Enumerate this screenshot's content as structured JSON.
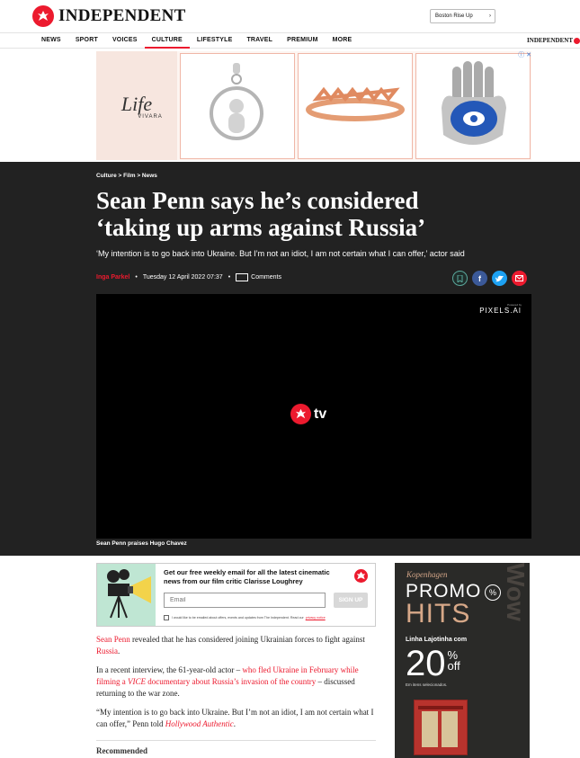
{
  "header": {
    "logo_text": "INDEPENDENT",
    "edition_label": "Boston Rise Up",
    "brand_color": "#ec1a2e"
  },
  "nav": {
    "items": [
      "NEWS",
      "SPORT",
      "VOICES",
      "CULTURE",
      "LIFESTYLE",
      "TRAVEL",
      "PREMIUM",
      "MORE"
    ],
    "active": "CULTURE",
    "right_logo_text": "INDEPENDENT"
  },
  "ad": {
    "brand": "Life",
    "sub_brand": "VIVARA"
  },
  "article": {
    "breadcrumb": "Culture > Film > News",
    "headline_line1": "Sean Penn says he’s considered",
    "headline_line2": "‘taking up arms against Russia’",
    "standfirst": "‘My intention is to go back into Ukraine. But I’m not an idiot, I am not certain what I can offer,’ actor said",
    "author": "Inga Parkel",
    "date": "Tuesday 12 April 2022 07:37",
    "comments_label": "Comments",
    "video": {
      "sponsor_small": "Powered by",
      "sponsor": "PIXELS.AI",
      "tv_label": "tv",
      "caption": "Sean Penn praises Hugo Chavez"
    }
  },
  "newsletter": {
    "title": "Get our free weekly email for all the latest cinematic news from our film critic Clarisse Loughrey",
    "email_placeholder": "Email",
    "signup_label": "SIGN UP",
    "consent_text": "I would like to be emailed about offers, events and updates from The Independent. Read our",
    "privacy_link": "privacy notice"
  },
  "body": {
    "p1_link": "Sean Penn",
    "p1_text_a": " revealed that he has considered joining Ukrainian forces to fight against ",
    "p1_link2": "Russia",
    "p1_text_b": ".",
    "p2_text_a": "In a recent interview, the 61-year-old actor – ",
    "p2_link_a": "who fled Ukraine in February while filming a ",
    "p2_link_i": "VICE",
    "p2_link_b": " documentary about Russia’s invasion of the country",
    "p2_text_b": " – discussed returning to the war zone.",
    "p3_text": "“My intention is to go back into Ukraine. But I’m not an idiot, I am not certain what I can offer,” Penn told ",
    "p3_link": "Hollywood Authentic",
    "p3_end": ".",
    "recommended": "Recommended"
  },
  "side_ad": {
    "brand": "Kopenhagen",
    "promo": "PROMO",
    "badge": "%",
    "hits": "HITS",
    "line": "Linha Lajotinha com",
    "pct": "20",
    "pct_sign": "%",
    "off": "off",
    "items": "Em itens selecionados.",
    "watermark": "Wow"
  }
}
